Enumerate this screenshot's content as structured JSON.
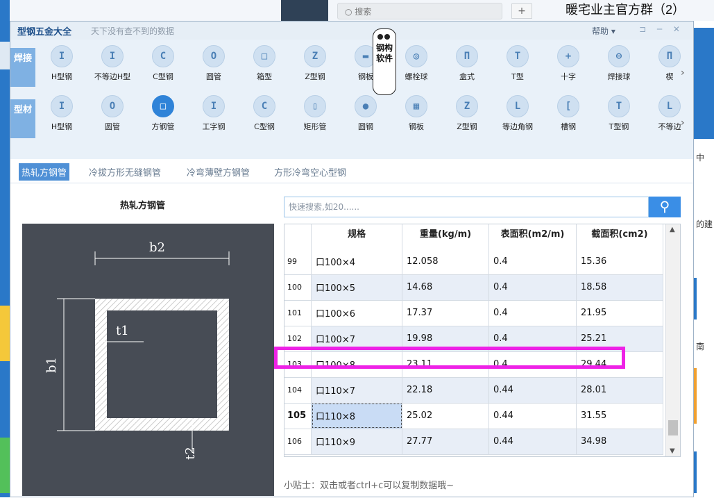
{
  "background": {
    "search_placeholder": "搜索",
    "plus": "+",
    "group_title": "暖宅业主官方群（2）",
    "right_snippets": [
      "中",
      "的建",
      "南"
    ]
  },
  "window": {
    "title": "型钢五金大全",
    "subtitle": "天下没有查不到的数据",
    "help": "帮助 ▾",
    "controls": "⊐ ─ ✕"
  },
  "mascot": {
    "text": "钢构软件"
  },
  "categories": [
    {
      "label": "焊接",
      "items": [
        {
          "label": "H型钢",
          "glyph": "I"
        },
        {
          "label": "不等边H型",
          "glyph": "I"
        },
        {
          "label": "C型钢",
          "glyph": "C"
        },
        {
          "label": "圆管",
          "glyph": "O"
        },
        {
          "label": "箱型",
          "glyph": "□"
        },
        {
          "label": "Z型钢",
          "glyph": "Z"
        },
        {
          "label": "钢板",
          "glyph": "▬"
        },
        {
          "label": "螺栓球",
          "glyph": "◎"
        },
        {
          "label": "盒式",
          "glyph": "Π"
        },
        {
          "label": "T型",
          "glyph": "T"
        },
        {
          "label": "十字",
          "glyph": "+"
        },
        {
          "label": "焊接球",
          "glyph": "⊖"
        },
        {
          "label": "楔",
          "glyph": "Π"
        }
      ]
    },
    {
      "label": "型材",
      "items": [
        {
          "label": "H型钢",
          "glyph": "I"
        },
        {
          "label": "圆管",
          "glyph": "O"
        },
        {
          "label": "方钢管",
          "glyph": "□"
        },
        {
          "label": "工字钢",
          "glyph": "I"
        },
        {
          "label": "C型钢",
          "glyph": "C"
        },
        {
          "label": "矩形管",
          "glyph": "▯"
        },
        {
          "label": "圆钢",
          "glyph": "●"
        },
        {
          "label": "钢板",
          "glyph": "▦"
        },
        {
          "label": "Z型钢",
          "glyph": "Z"
        },
        {
          "label": "等边角钢",
          "glyph": "L"
        },
        {
          "label": "槽钢",
          "glyph": "["
        },
        {
          "label": "T型钢",
          "glyph": "T"
        },
        {
          "label": "不等边",
          "glyph": "L"
        }
      ]
    }
  ],
  "subtabs": [
    "热轧方钢管",
    "冷拔方形无缝钢管",
    "冷弯薄壁方钢管",
    "方形冷弯空心型钢"
  ],
  "left_title": "热轧方钢管",
  "diagram_labels": {
    "b2": "b2",
    "b1": "b1",
    "t1": "t1",
    "t2": "t2"
  },
  "search_placeholder": "快速搜索,如20......",
  "table": {
    "columns": [
      "",
      "规格",
      "重量(kg/m)",
      "表面积(m2/m)",
      "截面积(cm2)"
    ],
    "rows": [
      [
        "99",
        "口100×4",
        "12.058",
        "0.4",
        "15.36"
      ],
      [
        "100",
        "口100×5",
        "14.68",
        "0.4",
        "18.58"
      ],
      [
        "101",
        "口100×6",
        "17.37",
        "0.4",
        "21.95"
      ],
      [
        "102",
        "口100×7",
        "19.98",
        "0.4",
        "25.21"
      ],
      [
        "103",
        "口100×8",
        "23.11",
        "0.4",
        "29.44"
      ],
      [
        "104",
        "口110×7",
        "22.18",
        "0.44",
        "28.01"
      ],
      [
        "105",
        "口110×8",
        "25.02",
        "0.44",
        "31.55"
      ],
      [
        "106",
        "口110×9",
        "27.77",
        "0.44",
        "34.98"
      ]
    ]
  },
  "tip": "小贴士：双击或者ctrl+c可以复制数据哦~",
  "colors": {
    "accent": "#3a8ee6",
    "highlight": "#ee22e6",
    "selected_cell": "#c9dcf5"
  }
}
